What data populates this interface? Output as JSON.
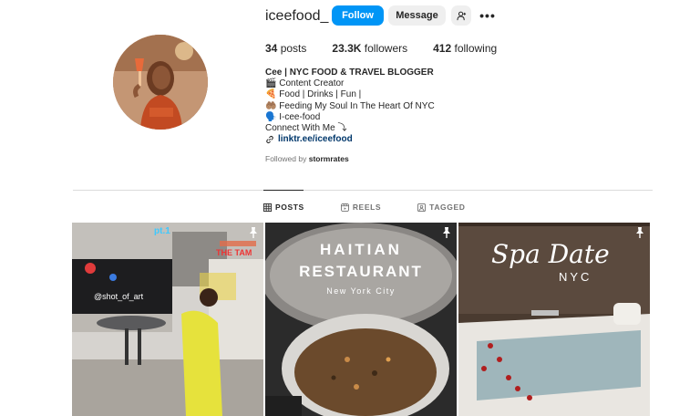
{
  "profile": {
    "username": "iceefood_",
    "follow_label": "Follow",
    "message_label": "Message",
    "more_label": "•••"
  },
  "stats": {
    "posts_count": "34",
    "posts_label": "posts",
    "followers_count": "23.3K",
    "followers_label": "followers",
    "following_count": "412",
    "following_label": "following"
  },
  "bio": {
    "name": "Cee | NYC FOOD & TRAVEL BLOGGER",
    "line1": "🎬 Content Creator",
    "line2": "🍕 Food | Drinks | Fun |",
    "line3": "🤲🏽 Feeding My Soul In The Heart Of NYC",
    "line4": "🗣️ I-cee-food",
    "line5": "Connect With Me ⤵",
    "link": "linktr.ee/iceefood"
  },
  "followed_by": {
    "prefix": "Followed by",
    "user": "stormrates"
  },
  "tabs": [
    {
      "label": "POSTS",
      "active": true
    },
    {
      "label": "REELS",
      "active": false
    },
    {
      "label": "TAGGED",
      "active": false
    }
  ],
  "posts": [
    {
      "caption": "@shot_of_art",
      "sign": "pt.1",
      "wall": "THE TAM"
    },
    {
      "caption_line1": "HAITIAN",
      "caption_line2": "RESTAURANT",
      "caption_line3": "New York City"
    },
    {
      "caption_line1": "Spa Date",
      "caption_line2": "NYC"
    }
  ]
}
